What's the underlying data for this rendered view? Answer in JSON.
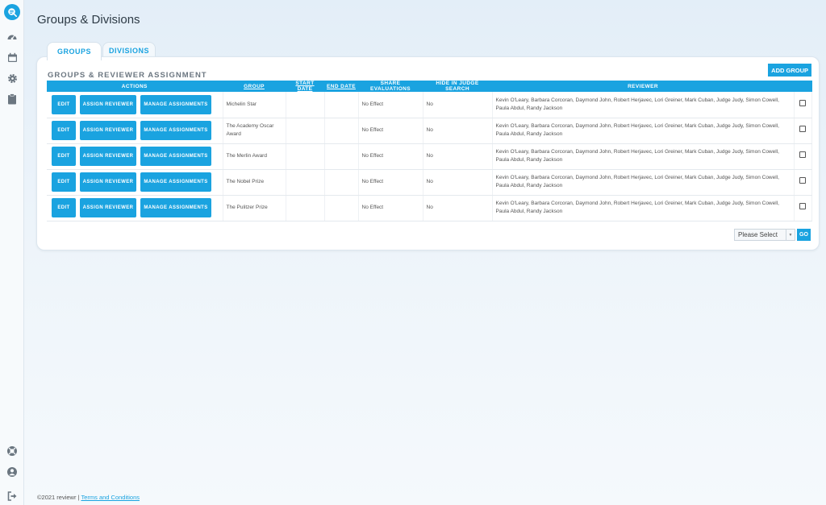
{
  "page": {
    "title": "Groups & Divisions"
  },
  "tabs": [
    {
      "label": "GROUPS",
      "active": true
    },
    {
      "label": "DIVISIONS",
      "active": false
    }
  ],
  "panel": {
    "title": "GROUPS & REVIEWER ASSIGNMENT",
    "add_group_label": "ADD GROUP"
  },
  "table": {
    "headers": {
      "actions": "ACTIONS",
      "group": "GROUP",
      "start_date": "START DATE",
      "end_date": "END DATE",
      "share": "SHARE EVALUATIONS",
      "hide": "HIDE IN JUDGE SEARCH",
      "reviewer": "REVIEWER"
    },
    "buttons": {
      "edit": "EDIT",
      "assign": "ASSIGN REVIEWER",
      "manage": "MANAGE ASSIGNMENTS"
    },
    "rows": [
      {
        "group": "Michelin Star",
        "start": "",
        "end": "",
        "share": "No Effect",
        "hide": "No",
        "reviewers": "Kevin O'Leary, Barbara Corcoran, Daymond John, Robert Herjavec, Lori Greiner, Mark Cuban, Judge Judy, Simon Cowell, Paula Abdul, Randy Jackson"
      },
      {
        "group": "The Academy Oscar Award",
        "start": "",
        "end": "",
        "share": "No Effect",
        "hide": "No",
        "reviewers": "Kevin O'Leary, Barbara Corcoran, Daymond John, Robert Herjavec, Lori Greiner, Mark Cuban, Judge Judy, Simon Cowell, Paula Abdul, Randy Jackson"
      },
      {
        "group": "The Merlin Award",
        "start": "",
        "end": "",
        "share": "No Effect",
        "hide": "No",
        "reviewers": "Kevin O'Leary, Barbara Corcoran, Daymond John, Robert Herjavec, Lori Greiner, Mark Cuban, Judge Judy, Simon Cowell, Paula Abdul, Randy Jackson"
      },
      {
        "group": "The Nobel Prize",
        "start": "",
        "end": "",
        "share": "No Effect",
        "hide": "No",
        "reviewers": "Kevin O'Leary, Barbara Corcoran, Daymond John, Robert Herjavec, Lori Greiner, Mark Cuban, Judge Judy, Simon Cowell, Paula Abdul, Randy Jackson"
      },
      {
        "group": "The Pulitzer Prize",
        "start": "",
        "end": "",
        "share": "No Effect",
        "hide": "No",
        "reviewers": "Kevin O'Leary, Barbara Corcoran, Daymond John, Robert Herjavec, Lori Greiner, Mark Cuban, Judge Judy, Simon Cowell, Paula Abdul, Randy Jackson"
      }
    ]
  },
  "bulk": {
    "select_value": "Please Select",
    "go_label": "GO"
  },
  "footer": {
    "copyright": "©2021 reviewr |",
    "terms_label": "Terms and Conditions"
  },
  "colors": {
    "accent": "#1aa3e0"
  },
  "icons": {
    "logo": "search-chat-icon",
    "nav": [
      "dashboard-gauge-icon",
      "calendar-icon",
      "gear-icon",
      "clipboard-icon"
    ],
    "bottom": [
      "help-lifebuoy-icon",
      "user-icon",
      "logout-icon"
    ]
  }
}
